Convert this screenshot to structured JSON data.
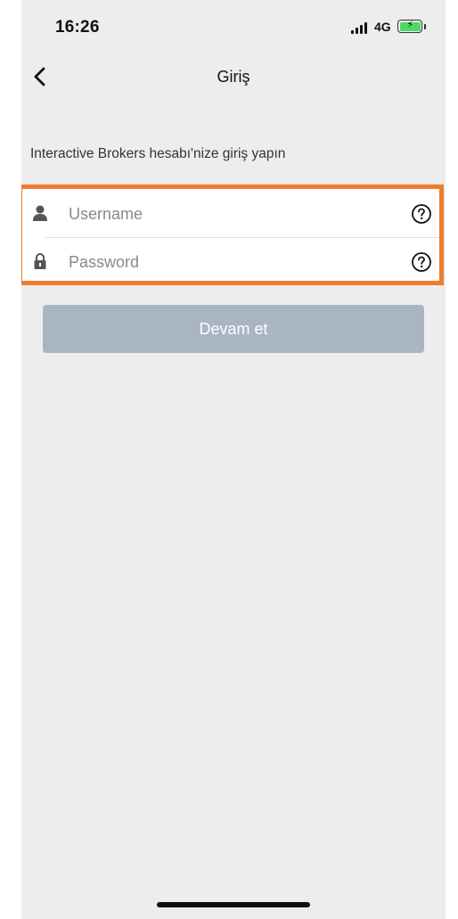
{
  "status_bar": {
    "time": "16:26",
    "network": "4G"
  },
  "nav": {
    "title": "Giriş",
    "back_icon": "chevron-left-icon"
  },
  "login": {
    "intro": "Interactive Brokers hesabı'nize giriş yapın",
    "username": {
      "placeholder": "Username",
      "value": "",
      "icon": "user-icon",
      "help_icon": "question-circle-icon"
    },
    "password": {
      "placeholder": "Password",
      "value": "",
      "icon": "lock-icon",
      "help_icon": "question-circle-icon"
    },
    "continue_label": "Devam et"
  },
  "colors": {
    "background": "#ededed",
    "highlight_border": "#ee7d2c",
    "button_disabled": "#aab5c3",
    "battery": "#4cd964"
  }
}
